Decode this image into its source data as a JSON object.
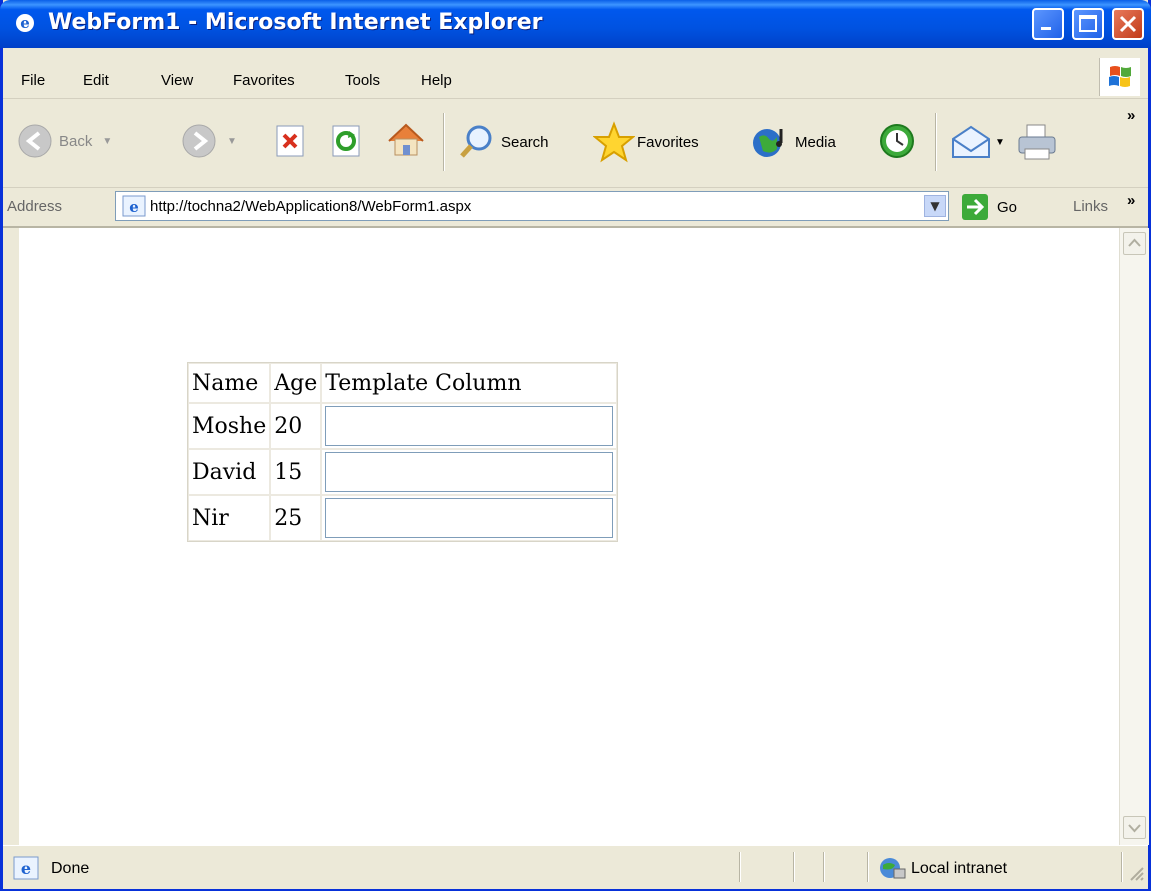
{
  "window": {
    "title": "WebForm1 - Microsoft Internet Explorer"
  },
  "menu": {
    "items": [
      "File",
      "Edit",
      "View",
      "Favorites",
      "Tools",
      "Help"
    ]
  },
  "toolbar": {
    "back_label": "Back",
    "search_label": "Search",
    "favorites_label": "Favorites",
    "media_label": "Media",
    "chevron": "»"
  },
  "address": {
    "label": "Address",
    "url": "http://tochna2/WebApplication8/WebForm1.aspx",
    "go_label": "Go",
    "links_label": "Links"
  },
  "grid": {
    "headers": [
      "Name",
      "Age",
      "Template Column"
    ],
    "rows": [
      {
        "name": "Moshe",
        "age": "20",
        "template_value": ""
      },
      {
        "name": "David",
        "age": "15",
        "template_value": ""
      },
      {
        "name": "Nir",
        "age": "25",
        "template_value": ""
      }
    ]
  },
  "status": {
    "text": "Done",
    "zone": "Local intranet"
  },
  "colors": {
    "titlebar": "#0054E3",
    "chrome": "#ECE9D8",
    "close_button": "#C13A18"
  }
}
